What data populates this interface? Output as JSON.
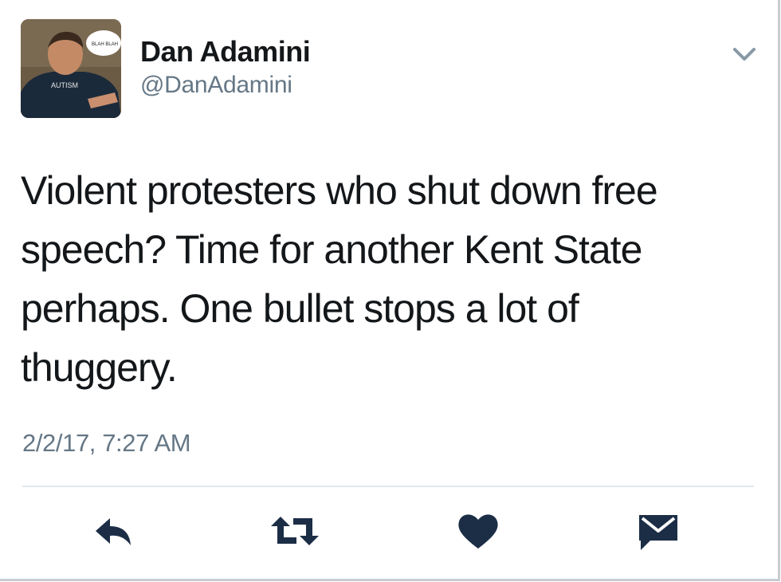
{
  "user": {
    "display_name": "Dan Adamini",
    "handle": "@DanAdamini",
    "avatar_icon": "profile-photo",
    "avatar_shirt_text": "AUTISM",
    "avatar_bubble_text": "BLAH BLAH"
  },
  "tweet": {
    "text": "Violent protesters who shut down free\nspeech? Time for another Kent State\nperhaps. One bullet stops a lot of\nthuggery.",
    "timestamp": "2/2/17, 7:27 AM"
  },
  "actions": [
    {
      "name": "reply",
      "icon": "reply-icon"
    },
    {
      "name": "retweet",
      "icon": "retweet-icon"
    },
    {
      "name": "like",
      "icon": "heart-icon"
    },
    {
      "name": "direct-message",
      "icon": "envelope-icon"
    }
  ],
  "colors": {
    "text_primary": "#14171a",
    "text_secondary": "#657786",
    "icon": "#1c2e46",
    "divider": "#e1e8ed"
  }
}
